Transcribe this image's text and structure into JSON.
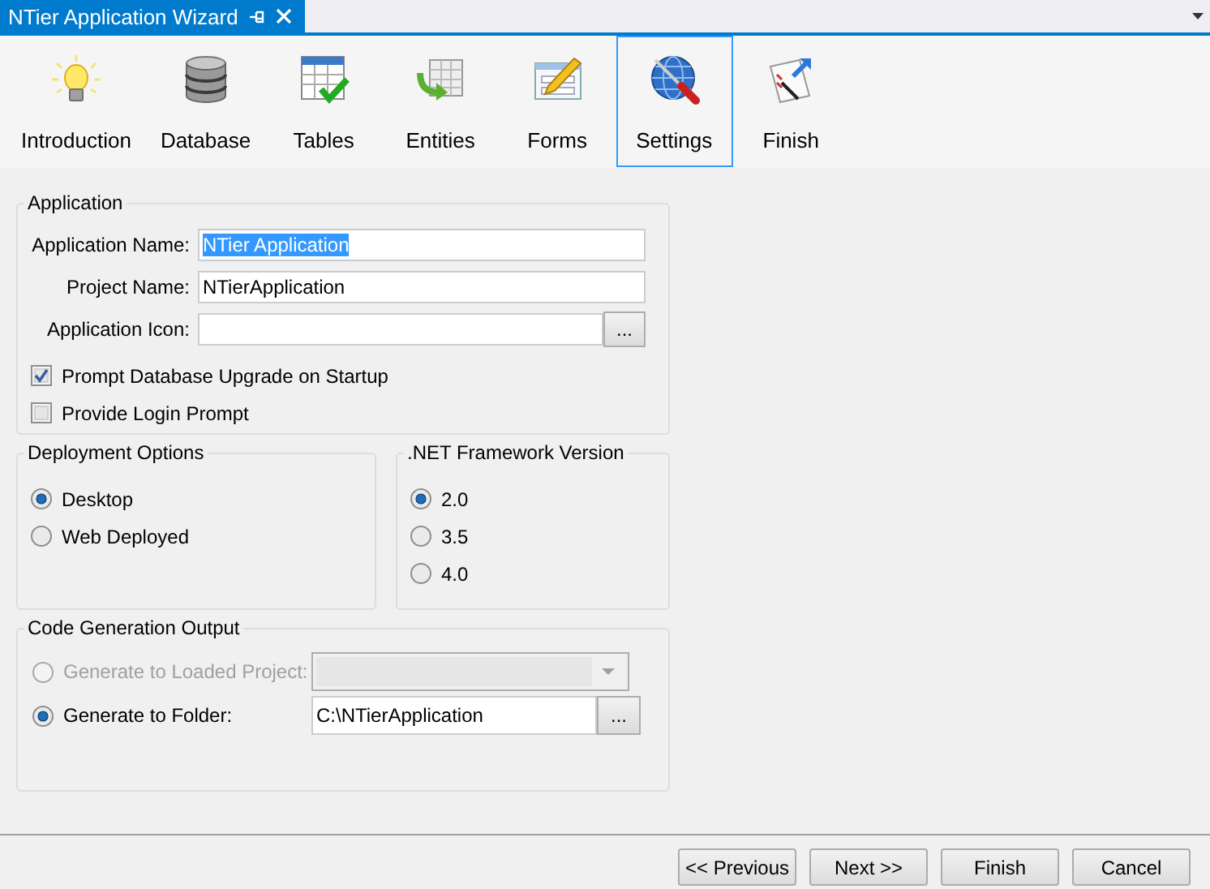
{
  "window": {
    "title": "NTier Application Wizard"
  },
  "steps": [
    {
      "label": "Introduction",
      "selected": false
    },
    {
      "label": "Database",
      "selected": false
    },
    {
      "label": "Tables",
      "selected": false
    },
    {
      "label": "Entities",
      "selected": false
    },
    {
      "label": "Forms",
      "selected": false
    },
    {
      "label": "Settings",
      "selected": true
    },
    {
      "label": "Finish",
      "selected": false
    }
  ],
  "application": {
    "title": "Application",
    "fields": [
      {
        "kind": "text",
        "label": "Application Name:",
        "value": "NTier Application",
        "text_selected": true
      },
      {
        "kind": "text",
        "label": "Project Name:",
        "value": "NTierApplication",
        "text_selected": false
      },
      {
        "kind": "file",
        "label": "Application Icon:",
        "browse": "..."
      }
    ],
    "checkboxes": [
      {
        "label": "Prompt Database Upgrade on Startup",
        "checked": true
      },
      {
        "label": "Provide Login Prompt",
        "checked": false
      }
    ]
  },
  "deployment": {
    "title": "Deployment Options",
    "options": [
      {
        "label": "Desktop",
        "selected": true
      },
      {
        "label": "Web Deployed",
        "selected": false
      }
    ]
  },
  "framework": {
    "title": ".NET Framework Version",
    "options": [
      {
        "label": "2.0",
        "selected": true
      },
      {
        "label": "3.5",
        "selected": false
      },
      {
        "label": "4.0",
        "selected": false
      }
    ]
  },
  "output": {
    "title": "Code Generation Output",
    "options": [
      {
        "kind": "combo",
        "label": "Generate to Loaded Project:",
        "selected": false,
        "disabled": true
      },
      {
        "kind": "folder",
        "label": "Generate to Folder:",
        "selected": true,
        "disabled": false,
        "value": "C:\\NTierApplication",
        "browse": "..."
      }
    ]
  },
  "buttons": [
    "<< Previous",
    "Next >>",
    "Finish",
    "Cancel"
  ]
}
